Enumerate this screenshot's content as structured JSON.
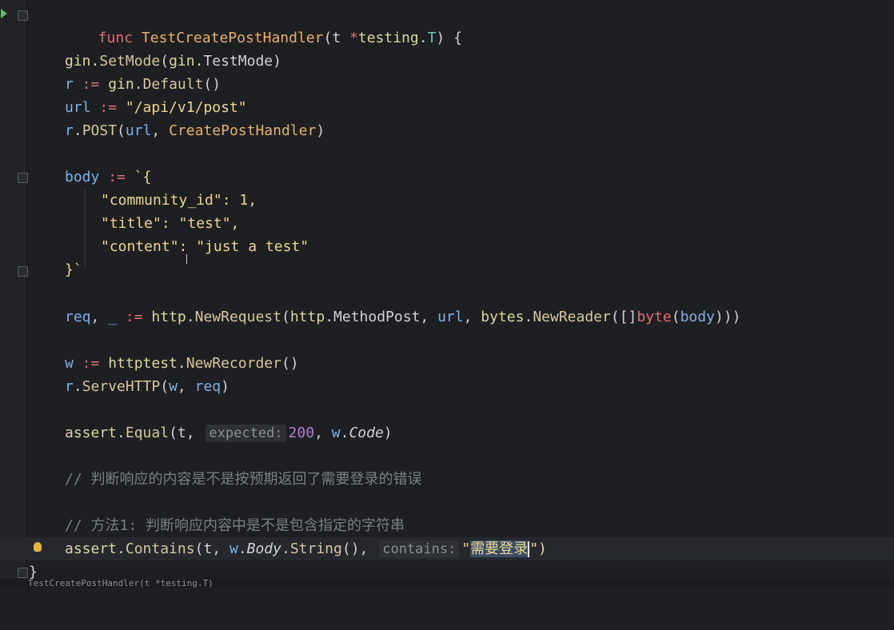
{
  "editor": {
    "lines": {
      "l1": {
        "kw": "func",
        "name": "TestCreatePostHandler",
        "open": "(",
        "param": "t",
        "star": "*",
        "pkg": "testing",
        "dot": ".",
        "type": "T",
        "close": ") {"
      },
      "l3": {
        "a": "gin",
        "b": ".",
        "c": "SetMode",
        "d": "(",
        "e": "gin",
        "f": ".",
        "g": "TestMode",
        "h": ")"
      },
      "l4": {
        "a": "r",
        "b": " := ",
        "c": "gin",
        "d": ".",
        "e": "Default",
        "f": "()"
      },
      "l5": {
        "a": "url",
        "b": " := ",
        "c": "\"/api/v1/post\""
      },
      "l6": {
        "a": "r",
        "b": ".",
        "c": "POST",
        "d": "(",
        "e": "url",
        "f": ", ",
        "g": "CreatePostHandler",
        "h": ")"
      },
      "l8": {
        "a": "body",
        "b": " := ",
        "c": "`{"
      },
      "l9": {
        "a": "\"community_id\": 1,"
      },
      "l10": {
        "a": "\"title\": \"test\","
      },
      "l11": {
        "a": "\"content\": \"just a test\""
      },
      "l12": {
        "a": "}`"
      },
      "l14": {
        "a": "req",
        "b": ", ",
        "c": "_",
        "d": " := ",
        "e": "http",
        "f": ".",
        "g": "NewRequest",
        "h": "(",
        "i": "http",
        "j": ".",
        "k": "MethodPost",
        "l": ", ",
        "m": "url",
        "n": ", ",
        "o": "bytes",
        "p": ".",
        "q": "NewReader",
        "r": "([]",
        "s": "byte",
        "t": "(",
        "u": "body",
        "v": ")))"
      },
      "l16": {
        "a": "w",
        "b": " := ",
        "c": "httptest",
        "d": ".",
        "e": "NewRecorder",
        "f": "()"
      },
      "l17": {
        "a": "r",
        "b": ".",
        "c": "ServeHTTP",
        "d": "(",
        "e": "w",
        "f": ", ",
        "g": "req",
        "h": ")"
      },
      "l19": {
        "a": "assert",
        "b": ".",
        "c": "Equal",
        "d": "(t, ",
        "hint": "expected:",
        "e": "200",
        "f": ", ",
        "g": "w",
        "h": ".",
        "i": "Code",
        "j": ")"
      },
      "l21": {
        "a": "// 判断响应的内容是不是按预期返回了需要登录的错误"
      },
      "l23": {
        "a": "// 方法1: 判断响应内容中是不是包含指定的字符串"
      },
      "l24": {
        "a": "assert",
        "b": ".",
        "c": "Contains",
        "d": "(t, ",
        "e": "w",
        "f": ".",
        "g": "Body",
        "h": ".",
        "i": "String",
        "j": "(), ",
        "hint": "contains:",
        "k": "\"",
        "sel": "需要登录",
        "m": "\")"
      },
      "l25": {
        "a": "}"
      }
    }
  },
  "statusbar": {
    "text": "TestCreatePostHandler(t *testing.T)"
  },
  "colors": {
    "background": "#1e1f22",
    "gutter": "#222326",
    "current_line": "#26282e"
  }
}
